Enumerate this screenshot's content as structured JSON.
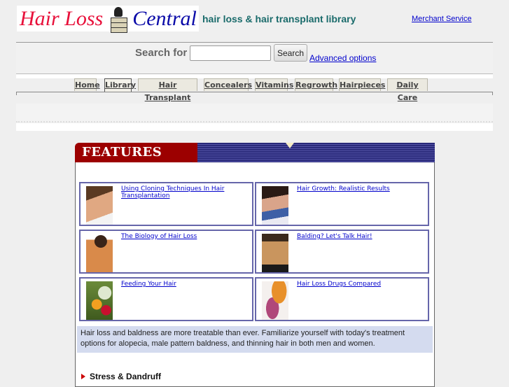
{
  "header": {
    "logo_word1": "Hair Loss",
    "logo_word2": "Central",
    "logo_icon": "books-lamp-icon",
    "tagline": "hair loss & hair transplant library",
    "merchant_link": "Merchant Service"
  },
  "search": {
    "label": "Search for",
    "value": "",
    "placeholder": "",
    "button": "Search",
    "advanced": "Advanced options"
  },
  "nav": {
    "tabs": [
      {
        "label": "Home",
        "active": false
      },
      {
        "label": "Library",
        "active": true
      },
      {
        "label": "Hair Transplant",
        "active": false
      },
      {
        "label": "Concealers",
        "active": false
      },
      {
        "label": "Vitamins",
        "active": false
      },
      {
        "label": "Regrowth",
        "active": false
      },
      {
        "label": "Hairpieces",
        "active": false
      },
      {
        "label": "Daily Care",
        "active": false
      }
    ]
  },
  "features": {
    "title": "FEATURES",
    "cards": [
      {
        "title": "Using Cloning Techniques In Hair Transplantation",
        "image": "smiling-man-photo"
      },
      {
        "title": "Hair Growth: Realistic Results",
        "image": "couple-embracing-photo"
      },
      {
        "title": "The Biology of Hair Loss",
        "image": "shirtless-man-photo"
      },
      {
        "title": "Balding? Let's Talk Hair!",
        "image": "man-portrait-photo"
      },
      {
        "title": "Feeding Your Hair",
        "image": "vegetables-photo"
      },
      {
        "title": "Hair Loss Drugs Compared",
        "image": "pill-bottle-photo"
      }
    ],
    "intro": "Hair loss and baldness are more treatable than ever. Familiarize yourself with today's treatment options for alopecia, male pattern baldness, and thinning hair in both men and women.",
    "section_heading": "Stress & Dandruff"
  },
  "colors": {
    "tagline": "#1a6b6b",
    "link": "#0000cc",
    "features_red": "#9c0000",
    "features_blue": "#2a2a7a",
    "card_border": "#6666aa",
    "intro_bg": "#d4dbef"
  }
}
